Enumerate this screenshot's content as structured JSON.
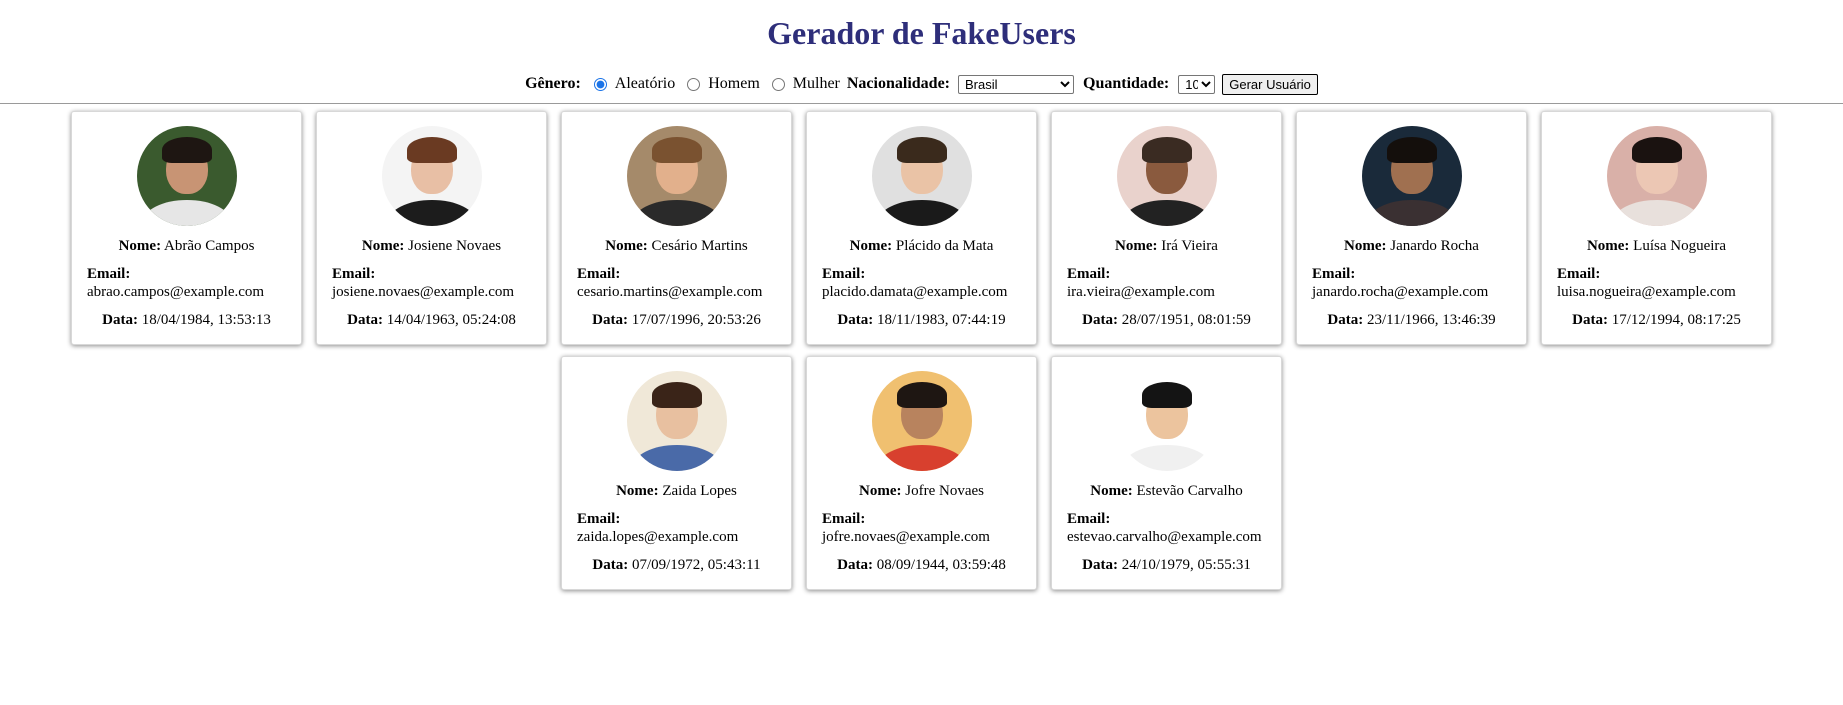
{
  "title": "Gerador de FakeUsers",
  "controls": {
    "genero_label": "Gênero:",
    "genero_options": [
      {
        "label": "Aleatório",
        "checked": true
      },
      {
        "label": "Homem",
        "checked": false
      },
      {
        "label": "Mulher",
        "checked": false
      }
    ],
    "nacionalidade_label": "Nacionalidade:",
    "nacionalidade_value": "Brasil",
    "quantidade_label": "Quantidade:",
    "quantidade_value": "10",
    "gerar_button": "Gerar Usuário"
  },
  "labels": {
    "nome": "Nome:",
    "email": "Email:",
    "data": "Data:"
  },
  "users": [
    {
      "nome": "Abrão Campos",
      "email": "abrao.campos@example.com",
      "data": "18/04/1984, 13:53:13",
      "colors": {
        "bg": "#3a5a2e",
        "skin": "#c89474",
        "hair": "#1e1612",
        "shirt": "#e6e6e6"
      }
    },
    {
      "nome": "Josiene Novaes",
      "email": "josiene.novaes@example.com",
      "data": "14/04/1963, 05:24:08",
      "colors": {
        "bg": "#f4f4f4",
        "skin": "#e8bfa5",
        "hair": "#6a3a22",
        "shirt": "#1c1c1c"
      }
    },
    {
      "nome": "Cesário Martins",
      "email": "cesario.martins@example.com",
      "data": "17/07/1996, 20:53:26",
      "colors": {
        "bg": "#a58a6a",
        "skin": "#e2b08c",
        "hair": "#7a5230",
        "shirt": "#2a2a2a"
      }
    },
    {
      "nome": "Plácido da Mata",
      "email": "placido.damata@example.com",
      "data": "18/11/1983, 07:44:19",
      "colors": {
        "bg": "#e0e0e0",
        "skin": "#eac3a6",
        "hair": "#3a2a1c",
        "shirt": "#1a1a1a"
      }
    },
    {
      "nome": "Irá Vieira",
      "email": "ira.vieira@example.com",
      "data": "28/07/1951, 08:01:59",
      "colors": {
        "bg": "#e9d2cc",
        "skin": "#8a5a3e",
        "hair": "#3a2b22",
        "shirt": "#222222"
      }
    },
    {
      "nome": "Janardo Rocha",
      "email": "janardo.rocha@example.com",
      "data": "23/11/1966, 13:46:39",
      "colors": {
        "bg": "#1a2a3a",
        "skin": "#a07050",
        "hair": "#140f0c",
        "shirt": "#3a3032"
      }
    },
    {
      "nome": "Luísa Nogueira",
      "email": "luisa.nogueira@example.com",
      "data": "17/12/1994, 08:17:25",
      "colors": {
        "bg": "#d9b0a8",
        "skin": "#ecc7b4",
        "hair": "#1a1210",
        "shirt": "#e8e0dc"
      }
    },
    {
      "nome": "Zaida Lopes",
      "email": "zaida.lopes@example.com",
      "data": "07/09/1972, 05:43:11",
      "colors": {
        "bg": "#f0e8d8",
        "skin": "#e8c0a0",
        "hair": "#3a2418",
        "shirt": "#4a6aa8"
      }
    },
    {
      "nome": "Jofre Novaes",
      "email": "jofre.novaes@example.com",
      "data": "08/09/1944, 03:59:48",
      "colors": {
        "bg": "#f0c070",
        "skin": "#b8835e",
        "hair": "#1e1612",
        "shirt": "#d8402e"
      }
    },
    {
      "nome": "Estevão Carvalho",
      "email": "estevao.carvalho@example.com",
      "data": "24/10/1979, 05:55:31",
      "colors": {
        "bg": "#ffffff",
        "skin": "#ecc49e",
        "hair": "#141414",
        "shirt": "#f0f0f0"
      }
    }
  ]
}
